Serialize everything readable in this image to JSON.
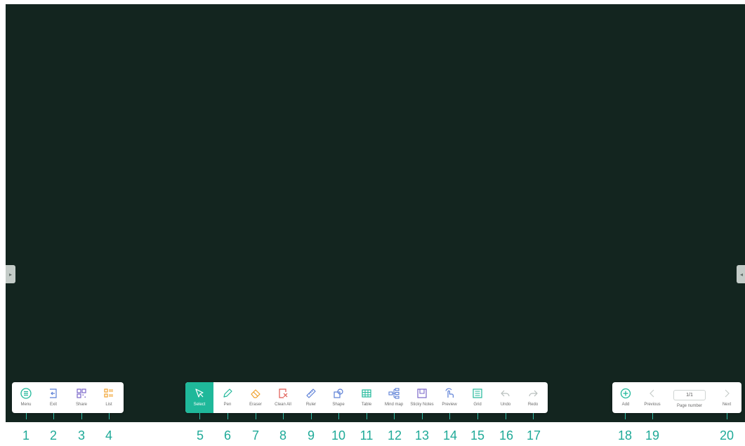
{
  "left_bar": [
    {
      "label": "Menu",
      "icon": "menu-icon"
    },
    {
      "label": "Exit",
      "icon": "exit-icon"
    },
    {
      "label": "Share",
      "icon": "share-icon"
    },
    {
      "label": "List",
      "icon": "list-icon"
    }
  ],
  "center_bar": [
    {
      "label": "Select",
      "icon": "select-cursor-icon"
    },
    {
      "label": "Pen",
      "icon": "pen-icon"
    },
    {
      "label": "Eraser",
      "icon": "eraser-icon"
    },
    {
      "label": "Clean All",
      "icon": "clean-all-icon"
    },
    {
      "label": "Ruler",
      "icon": "ruler-icon"
    },
    {
      "label": "Shape",
      "icon": "shape-icon"
    },
    {
      "label": "Table",
      "icon": "table-icon"
    },
    {
      "label": "Mind map",
      "icon": "mind-map-icon"
    },
    {
      "label": "Sticky Notes",
      "icon": "sticky-notes-icon"
    },
    {
      "label": "Preview",
      "icon": "preview-icon"
    },
    {
      "label": "Grid",
      "icon": "grid-icon"
    },
    {
      "label": "Undo",
      "icon": "undo-icon"
    },
    {
      "label": "Redo",
      "icon": "redo-icon"
    }
  ],
  "right_bar": {
    "add_label": "Add",
    "previous_label": "Previous",
    "page_value": "1/1",
    "page_label": "Page number",
    "next_label": "Next"
  },
  "callouts": [
    "1",
    "2",
    "3",
    "4",
    "5",
    "6",
    "7",
    "8",
    "9",
    "10",
    "11",
    "12",
    "13",
    "14",
    "15",
    "16",
    "17",
    "18",
    "19",
    "20"
  ],
  "colors": {
    "board": "#13251f",
    "accent": "#1fb89a",
    "callout": "#1faa98"
  }
}
